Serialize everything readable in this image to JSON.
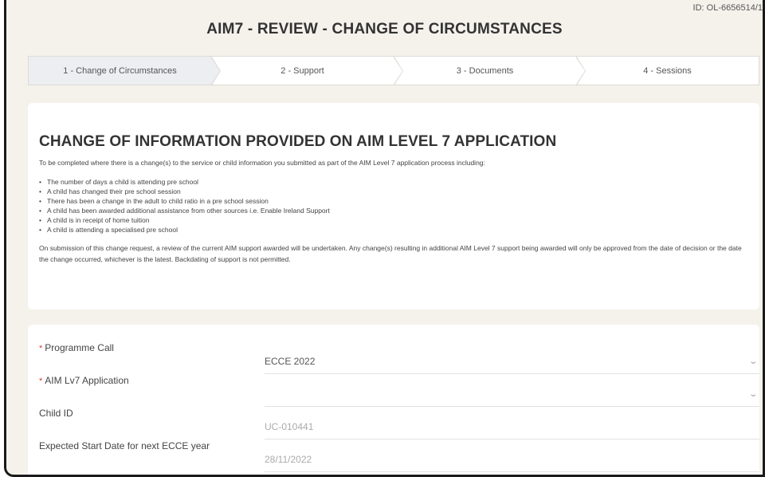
{
  "record_id": "ID: OL-6656514/1",
  "title": "AIM7 - REVIEW - CHANGE OF CIRCUMSTANCES",
  "steps": [
    {
      "label": "1 - Change of Circumstances",
      "active": true
    },
    {
      "label": "2 - Support",
      "active": false
    },
    {
      "label": "3 - Documents",
      "active": false
    },
    {
      "label": "4 - Sessions",
      "active": false
    }
  ],
  "info": {
    "heading": "CHANGE OF INFORMATION PROVIDED ON AIM LEVEL 7 APPLICATION",
    "intro": "To be completed where there is a change(s) to the service or child information you submitted as part of the AIM Level 7 application process including:",
    "bullets": [
      "The number of days a child is attending pre school",
      "A child has changed their pre school session",
      "There has been a change in the adult to child ratio in a pre school session",
      "A child has been awarded additional assistance from other sources i.e. Enable Ireland Support",
      "A child is in receipt of home tuition",
      "A child is attending a specialised pre school"
    ],
    "footer": "On submission of this change request, a review of the current AIM support awarded will be undertaken. Any change(s) resulting in additional AIM Level 7 support being awarded will only be approved from the date of decision or the date the change occurred, whichever is the latest. Backdating of support is not permitted."
  },
  "form": {
    "required_mark": "*",
    "dropdown_glyph": "⌄",
    "programme_call": {
      "label": "Programme Call",
      "value": "ECCE 2022"
    },
    "aim_application": {
      "label": "AIM Lv7 Application",
      "value": ""
    },
    "child_id": {
      "label": "Child ID",
      "value": "UC-010441"
    },
    "start_date": {
      "label": "Expected Start Date for next ECCE year",
      "value": "28/11/2022"
    }
  },
  "colors": {
    "page_background": "#f5f2ec",
    "active_step": "#eceef2",
    "required": "#d6452f"
  }
}
